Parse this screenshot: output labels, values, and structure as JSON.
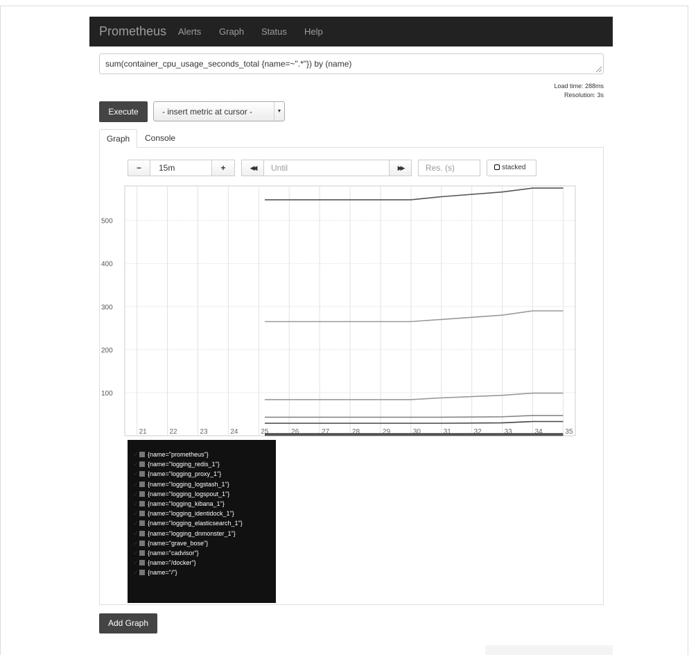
{
  "navbar": {
    "brand": "Prometheus",
    "links": [
      "Alerts",
      "Graph",
      "Status",
      "Help"
    ]
  },
  "expression": "sum(container_cpu_usage_seconds_total {name=~\".*\"}) by (name)",
  "load_info": {
    "load_time": "Load time: 288ms",
    "resolution": "Resolution: 3s"
  },
  "execute_label": "Execute",
  "metric_select": {
    "selected": "- insert metric at cursor -"
  },
  "tabs": [
    "Graph",
    "Console"
  ],
  "controls": {
    "minus": "−",
    "range": "15m",
    "plus": "+",
    "back": "◀◀",
    "until_placeholder": "Until",
    "forward": "▶▶",
    "res_placeholder": "Res. (s)",
    "stacked": "stacked"
  },
  "legend": [
    "{name=\"prometheus\"}",
    "{name=\"logging_redis_1\"}",
    "{name=\"logging_proxy_1\"}",
    "{name=\"logging_logstash_1\"}",
    "{name=\"logging_logspout_1\"}",
    "{name=\"logging_kibana_1\"}",
    "{name=\"logging_identidock_1\"}",
    "{name=\"logging_elasticsearch_1\"}",
    "{name=\"logging_dnmonster_1\"}",
    "{name=\"grave_bose\"}",
    "{name=\"cadvisor\"}",
    "{name=\"/docker\"}",
    "{name=\"/\"}"
  ],
  "add_graph_label": "Add Graph",
  "colors": {
    "navbar": "#222222",
    "button": "#444444",
    "legend_bg": "#111111",
    "grid": "#dddddd"
  },
  "chart_data": {
    "type": "line",
    "title": "",
    "xlabel": "",
    "ylabel": "",
    "x_ticks": [
      "21",
      "22",
      "23",
      "24",
      "25",
      "26",
      "27",
      "28",
      "29",
      "30",
      "31",
      "32",
      "33",
      "34",
      "35"
    ],
    "y_ticks": [
      100,
      200,
      300,
      400,
      500
    ],
    "xlim": [
      20.6,
      35.4
    ],
    "ylim": [
      0,
      580
    ],
    "grid": true,
    "series": [
      {
        "color": "#555555",
        "points": [
          [
            25.2,
            548
          ],
          [
            30,
            548
          ],
          [
            31,
            555
          ],
          [
            33,
            566
          ],
          [
            34,
            575
          ],
          [
            35,
            575
          ]
        ]
      },
      {
        "color": "#999999",
        "points": [
          [
            25.2,
            265
          ],
          [
            30,
            265
          ],
          [
            31,
            270
          ],
          [
            33,
            280
          ],
          [
            34,
            290
          ],
          [
            35,
            290
          ]
        ]
      },
      {
        "color": "#999999",
        "points": [
          [
            25.2,
            84
          ],
          [
            30,
            84
          ],
          [
            31,
            88
          ],
          [
            33,
            94
          ],
          [
            34,
            99
          ],
          [
            35,
            99
          ]
        ]
      },
      {
        "color": "#888888",
        "points": [
          [
            25.2,
            43
          ],
          [
            30,
            43
          ],
          [
            31,
            43
          ],
          [
            33,
            44
          ],
          [
            34,
            47
          ],
          [
            35,
            47
          ]
        ]
      },
      {
        "color": "#444444",
        "points": [
          [
            25.2,
            29
          ],
          [
            30,
            29
          ],
          [
            31,
            29
          ],
          [
            33,
            30
          ],
          [
            34,
            33
          ],
          [
            35,
            33
          ]
        ]
      },
      {
        "color": "#555555",
        "points": [
          [
            25.2,
            5
          ],
          [
            35,
            5
          ]
        ]
      },
      {
        "color": "#555555",
        "points": [
          [
            25.2,
            3
          ],
          [
            35,
            3
          ]
        ]
      },
      {
        "color": "#555555",
        "points": [
          [
            25.2,
            2
          ],
          [
            35,
            2
          ]
        ]
      },
      {
        "color": "#555555",
        "points": [
          [
            25.2,
            1
          ],
          [
            35,
            1
          ]
        ]
      }
    ]
  }
}
